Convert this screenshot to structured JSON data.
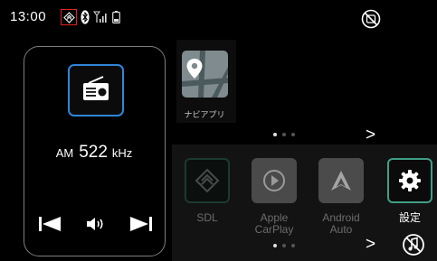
{
  "status_bar": {
    "time": "13:00"
  },
  "radio": {
    "band": "AM",
    "frequency": "522",
    "unit": "kHz"
  },
  "navi_app": {
    "label": "ナビアプリ"
  },
  "apps": [
    {
      "id": "sdl",
      "label": "SDL"
    },
    {
      "id": "carplay",
      "label": "Apple\nCarPlay"
    },
    {
      "id": "android",
      "label": "Android\nAuto"
    },
    {
      "id": "settings",
      "label": "設定"
    }
  ],
  "pagination": {
    "top_active": 1,
    "bottom_active": 1,
    "total": 3,
    "next": ">"
  },
  "colors": {
    "accent_blue": "#2f86d6",
    "accent_teal": "#3f9f86",
    "alert_red": "#e0221c"
  },
  "icons": [
    "sdl-icon",
    "bluetooth-icon",
    "signal-icon",
    "battery-icon",
    "no-connection-icon",
    "radio-icon",
    "previous-track-icon",
    "volume-icon",
    "next-track-icon",
    "map-icon",
    "carplay-icon",
    "android-auto-icon",
    "gear-icon",
    "no-music-icon"
  ]
}
